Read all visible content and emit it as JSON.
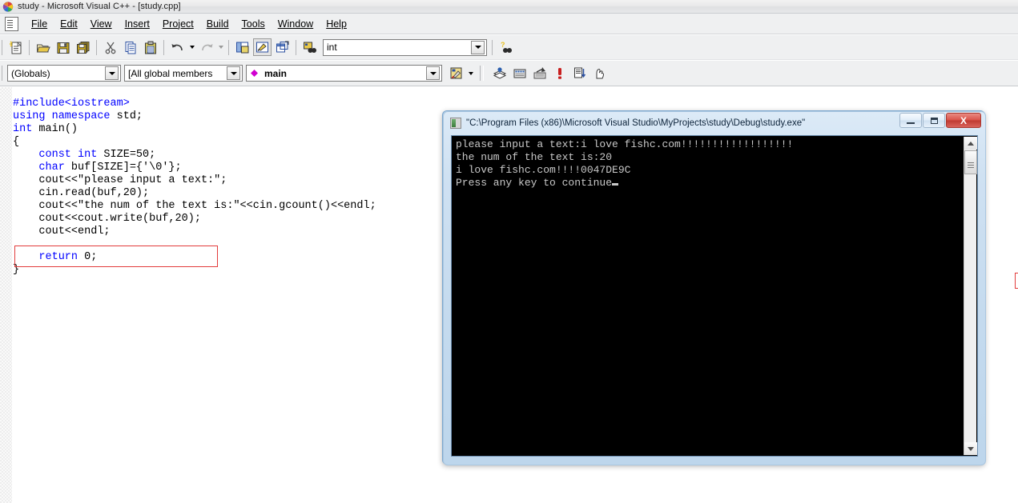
{
  "window": {
    "title": "study - Microsoft Visual C++ - [study.cpp]",
    "app_icon": "visual-cpp-logo-icon"
  },
  "menubar": {
    "doc_icon": "document-icon",
    "items": [
      {
        "label": "File"
      },
      {
        "label": "Edit"
      },
      {
        "label": "View"
      },
      {
        "label": "Insert"
      },
      {
        "label": "Project"
      },
      {
        "label": "Build"
      },
      {
        "label": "Tools"
      },
      {
        "label": "Window"
      },
      {
        "label": "Help"
      }
    ]
  },
  "toolbar_standard": {
    "buttons": [
      {
        "name": "new-text-file-icon",
        "title": "New Text File"
      },
      {
        "name": "open-folder-icon",
        "title": "Open"
      },
      {
        "name": "save-floppy-icon",
        "title": "Save"
      },
      {
        "name": "save-all-icon",
        "title": "Save All"
      },
      {
        "name": "cut-scissors-icon",
        "title": "Cut"
      },
      {
        "name": "copy-pages-icon",
        "title": "Copy"
      },
      {
        "name": "paste-clipboard-icon",
        "title": "Paste"
      },
      {
        "name": "undo-arrow-icon",
        "title": "Undo"
      },
      {
        "name": "redo-arrow-icon",
        "title": "Redo"
      },
      {
        "name": "workspace-window-icon",
        "title": "Workspace"
      },
      {
        "name": "output-window-icon",
        "title": "Output"
      },
      {
        "name": "window-list-icon",
        "title": "Windows"
      },
      {
        "name": "find-in-files-icon",
        "title": "Find in Files"
      }
    ],
    "find_combo": {
      "value": "int",
      "placeholder": ""
    },
    "help_button": {
      "name": "search-help-icon",
      "title": "Search"
    }
  },
  "toolbar_wizardbar": {
    "globals_combo": {
      "value": "(Globals)"
    },
    "members_combo": {
      "value": "[All global members"
    },
    "function_combo": {
      "value": "main",
      "icon": "member-diamond-icon"
    },
    "action_button": {
      "name": "wizardbar-action-icon"
    },
    "buttons": [
      {
        "name": "compile-icon",
        "title": "Compile"
      },
      {
        "name": "build-icon",
        "title": "Build"
      },
      {
        "name": "stop-build-icon",
        "title": "Stop Build"
      },
      {
        "name": "execute-program-icon",
        "title": "Execute Program"
      },
      {
        "name": "go-debug-icon",
        "title": "Go"
      },
      {
        "name": "insert-breakpoint-icon",
        "title": "Insert/Remove Breakpoint"
      }
    ]
  },
  "editor": {
    "lines": [
      [
        {
          "t": "#include<iostream>",
          "k": true
        }
      ],
      [
        {
          "t": "using namespace",
          "k": true
        },
        {
          "t": " std;",
          "k": false
        }
      ],
      [
        {
          "t": "int",
          "k": true
        },
        {
          "t": " main()",
          "k": false
        }
      ],
      [
        {
          "t": "{",
          "k": false
        }
      ],
      [
        {
          "t": "    ",
          "k": false
        },
        {
          "t": "const int",
          "k": true
        },
        {
          "t": " SIZE=50;",
          "k": false
        }
      ],
      [
        {
          "t": "    ",
          "k": false
        },
        {
          "t": "char",
          "k": true
        },
        {
          "t": " buf[SIZE]={'\\0'};",
          "k": false
        }
      ],
      [
        {
          "t": "    cout<<\"please input a text:\";",
          "k": false
        }
      ],
      [
        {
          "t": "    cin.read(buf,20);",
          "k": false
        }
      ],
      [
        {
          "t": "    cout<<\"the num of the text is:\"<<cin.gcount()<<endl;",
          "k": false
        }
      ],
      [
        {
          "t": "    cout<<cout.write(buf,20);",
          "k": false
        }
      ],
      [
        {
          "t": "    cout<<endl;",
          "k": false
        }
      ],
      [
        {
          "t": "",
          "k": false
        }
      ],
      [
        {
          "t": "    ",
          "k": false
        },
        {
          "t": "return",
          "k": true
        },
        {
          "t": " 0;",
          "k": false
        }
      ],
      [
        {
          "t": "}",
          "k": false
        }
      ]
    ],
    "annotation_color": "#e23c3c"
  },
  "console": {
    "title": "\"C:\\Program Files (x86)\\Microsoft Visual Studio\\MyProjects\\study\\Debug\\study.exe\"",
    "icon": "console-app-icon",
    "controls": {
      "minimize": {
        "name": "minimize-button",
        "glyph": "—"
      },
      "maximize": {
        "name": "maximize-button",
        "glyph": "□"
      },
      "close": {
        "name": "close-button",
        "glyph": "X"
      }
    },
    "lines": [
      "please input a text:i love fishc.com!!!!!!!!!!!!!!!!!!",
      "the num of the text is:20",
      "i love fishc.com!!!!0047DE9C",
      "Press any key to continue"
    ],
    "cursor": "block-cursor",
    "annotation_color": "#e23c3c",
    "scrollbar": {
      "up": "scroll-up-arrow-icon",
      "down": "scroll-down-arrow-icon",
      "thumb": "scroll-thumb"
    }
  }
}
